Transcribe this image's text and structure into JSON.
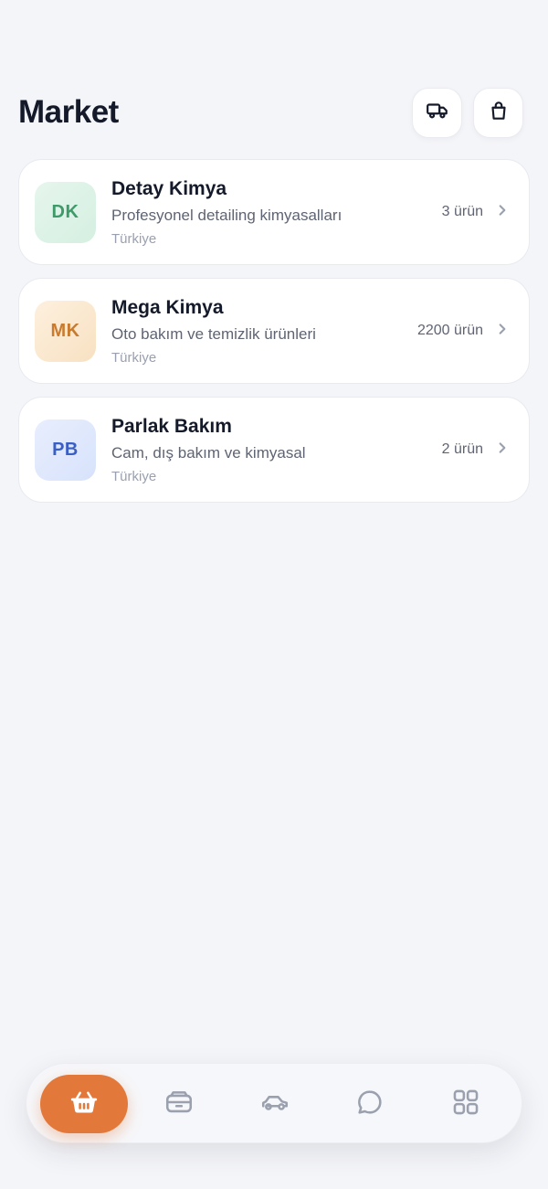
{
  "header": {
    "title": "Market",
    "actions": [
      {
        "icon": "truck-icon",
        "label": ""
      },
      {
        "icon": "shopping-bag-icon",
        "label": ""
      }
    ]
  },
  "stores": [
    {
      "initials": "DK",
      "name": "Detay Kimya",
      "description": "Profesyonel detailing kimyasalları",
      "country": "Türkiye",
      "count": "3 ürün",
      "accent": "#3f9a6a",
      "bg": "#dff3e8"
    },
    {
      "initials": "MK",
      "name": "Mega Kimya",
      "description": "Oto bakım ve temizlik ürünleri",
      "country": "Türkiye",
      "count": "2200 ürün",
      "accent": "#c97a2c",
      "bg": "#fbead4"
    },
    {
      "initials": "PB",
      "name": "Parlak Bakım",
      "description": "Cam, dış bakım ve kimyasal",
      "country": "Türkiye",
      "count": "2 ürün",
      "accent": "#3a5fc4",
      "bg": "#e1e9fc"
    }
  ],
  "nav": {
    "active_color": "#e2793a",
    "items": [
      {
        "icon": "basket-icon",
        "active": true
      },
      {
        "icon": "inbox-icon",
        "active": false
      },
      {
        "icon": "car-icon",
        "active": false
      },
      {
        "icon": "chat-icon",
        "active": false
      },
      {
        "icon": "grid-icon",
        "active": false
      }
    ]
  }
}
